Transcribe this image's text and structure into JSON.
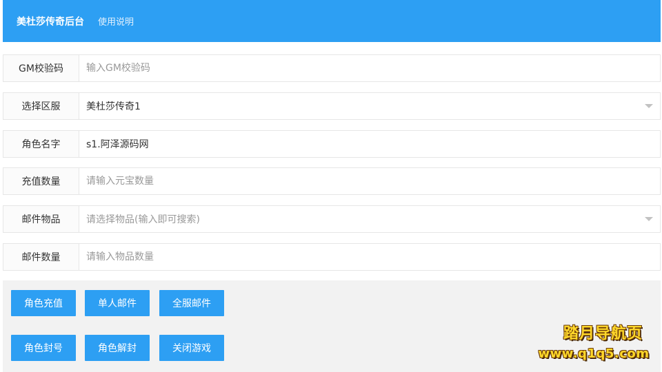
{
  "header": {
    "title": "美杜莎传奇后台",
    "help_link": "使用说明"
  },
  "form": {
    "gm_code": {
      "label": "GM校验码",
      "value": "",
      "placeholder": "输入GM校验码"
    },
    "server": {
      "label": "选择区服",
      "selected": "美杜莎传奇1"
    },
    "role_name": {
      "label": "角色名字",
      "value": "s1.阿泽源码网",
      "placeholder": ""
    },
    "recharge_amount": {
      "label": "充值数量",
      "value": "",
      "placeholder": "请输入元宝数量"
    },
    "mail_item": {
      "label": "邮件物品",
      "placeholder": "请选择物品(输入即可搜索)"
    },
    "mail_quantity": {
      "label": "邮件数量",
      "value": "",
      "placeholder": "请输入物品数量"
    }
  },
  "actions": {
    "role_recharge": "角色充值",
    "single_mail": "单人邮件",
    "server_mail": "全服邮件",
    "ban_role": "角色封号",
    "unban_role": "角色解封",
    "close_game": "关闭游戏"
  },
  "watermark": {
    "title": "踏月导航页",
    "url": "www.q1q5.com"
  },
  "colors": {
    "primary": "#2d9ff3",
    "panel_bg": "#f2f2f2",
    "border": "#e6e6e6",
    "watermark_fill": "#ffd82a"
  }
}
